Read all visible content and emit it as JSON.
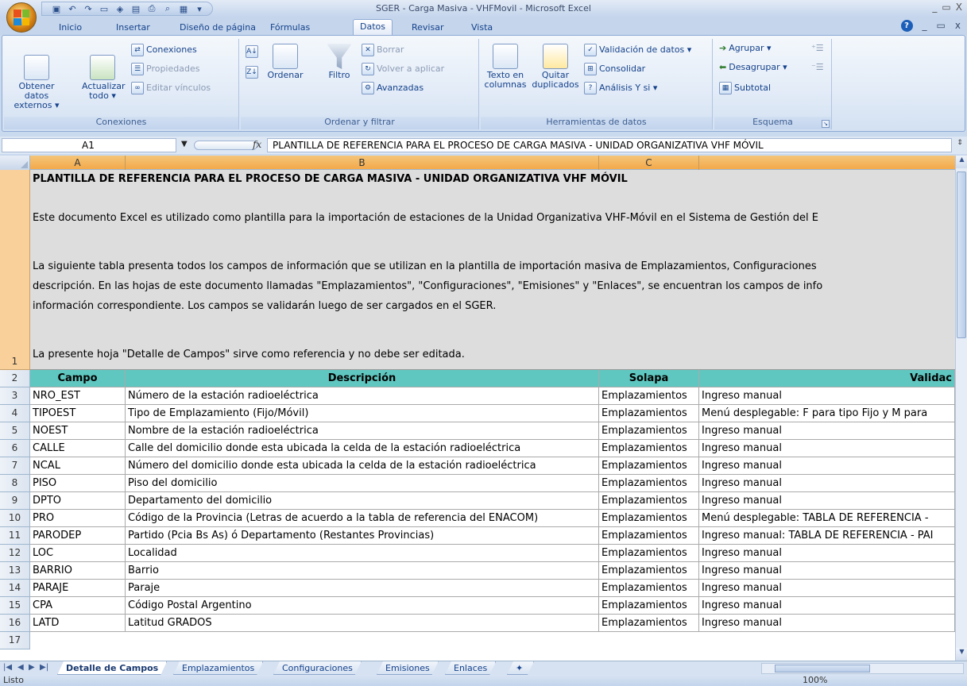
{
  "window": {
    "title": "SGER - Carga Masiva - VHFMovil - Microsoft Excel",
    "controls": [
      "_",
      "▭",
      "X"
    ]
  },
  "tabs": [
    "Inicio",
    "Insertar",
    "Diseño de página",
    "Fórmulas",
    "Datos",
    "Revisar",
    "Vista"
  ],
  "active_tab": "Datos",
  "ribbon": {
    "groups": {
      "conexiones": {
        "label": "Conexiones",
        "obtener": "Obtener datos externos ▾",
        "actualizar": "Actualizar todo ▾",
        "conexiones": "Conexiones",
        "propiedades": "Propiedades",
        "editar": "Editar vínculos"
      },
      "ordenar": {
        "label": "Ordenar y filtrar",
        "ordenar": "Ordenar",
        "filtro": "Filtro",
        "borrar": "Borrar",
        "volver": "Volver a aplicar",
        "avanzadas": "Avanzadas"
      },
      "herramientas": {
        "label": "Herramientas de datos",
        "texto": "Texto en columnas",
        "quitar": "Quitar duplicados",
        "validacion": "Validación de datos ▾",
        "consolidar": "Consolidar",
        "analisis": "Análisis Y si ▾"
      },
      "esquema": {
        "label": "Esquema",
        "agrupar": "Agrupar ▾",
        "desagrupar": "Desagrupar ▾",
        "subtotal": "Subtotal"
      }
    }
  },
  "formula_bar": {
    "name_box": "A1",
    "fx": "fx",
    "content": "PLANTILLA DE REFERENCIA PARA EL PROCESO DE CARGA MASIVA - UNIDAD ORGANIZATIVA VHF MÓVIL"
  },
  "columns": [
    "A",
    "B",
    "C"
  ],
  "row1": {
    "title": "PLANTILLA DE REFERENCIA PARA EL PROCESO DE CARGA MASIVA - UNIDAD ORGANIZATIVA VHF MÓVIL",
    "p1": "Este documento Excel es utilizado como plantilla para la importación de estaciones de la Unidad Organizativa VHF-Móvil en el Sistema de Gestión del E",
    "p2a": "La siguiente tabla presenta todos los campos de información que se utilizan en la plantilla de importación masiva de Emplazamientos, Configuraciones",
    "p2b": "descripción. En las hojas de este documento llamadas \"Emplazamientos\", \"Configuraciones\", \"Emisiones\" y \"Enlaces\", se encuentran los campos de info",
    "p2c": "información correspondiente. Los campos se validarán luego de ser cargados en el SGER.",
    "p3": "La presente hoja \"Detalle de Campos\" sirve como referencia y no debe ser editada."
  },
  "table": {
    "headers": [
      "Campo",
      "Descripción",
      "Solapa",
      "Validac"
    ],
    "rows": [
      [
        "NRO_EST",
        "Número de la estación radioeléctrica",
        "Emplazamientos",
        "Ingreso manual"
      ],
      [
        "TIPOEST",
        "Tipo de Emplazamiento (Fijo/Móvil)",
        "Emplazamientos",
        "Menú desplegable: F para tipo Fijo y M para"
      ],
      [
        "NOEST",
        "Nombre de la estación radioeléctrica",
        "Emplazamientos",
        "Ingreso manual"
      ],
      [
        "CALLE",
        "Calle del domicilio donde esta ubicada la celda de la estación radioeléctrica",
        "Emplazamientos",
        "Ingreso manual"
      ],
      [
        "NCAL",
        "Número del domicilio donde esta ubicada la celda de la estación radioeléctrica",
        "Emplazamientos",
        "Ingreso manual"
      ],
      [
        "PISO",
        "Piso del domicilio",
        "Emplazamientos",
        "Ingreso manual"
      ],
      [
        "DPTO",
        "Departamento del domicilio",
        "Emplazamientos",
        "Ingreso manual"
      ],
      [
        "PRO",
        "Código de la Provincia (Letras de acuerdo a la tabla de referencia del ENACOM)",
        "Emplazamientos",
        "Menú desplegable: TABLA DE REFERENCIA -"
      ],
      [
        "PARODEP",
        "Partido (Pcia Bs As) ó Departamento (Restantes Provincias)",
        "Emplazamientos",
        "Ingreso manual: TABLA DE REFERENCIA - PAI"
      ],
      [
        "LOC",
        "Localidad",
        "Emplazamientos",
        "Ingreso manual"
      ],
      [
        "BARRIO",
        "Barrio",
        "Emplazamientos",
        "Ingreso manual"
      ],
      [
        "PARAJE",
        "Paraje",
        "Emplazamientos",
        "Ingreso manual"
      ],
      [
        "CPA",
        "Código Postal Argentino",
        "Emplazamientos",
        "Ingreso manual"
      ],
      [
        "LATD",
        "Latitud GRADOS",
        "Emplazamientos",
        "Ingreso manual"
      ]
    ],
    "row_numbers": [
      "3",
      "4",
      "5",
      "6",
      "7",
      "8",
      "9",
      "10",
      "11",
      "12",
      "13",
      "14",
      "15",
      "16",
      "17"
    ]
  },
  "sheets": [
    "Detalle de Campos",
    "Emplazamientos",
    "Configuraciones",
    "Emisiones",
    "Enlaces"
  ],
  "active_sheet": "Detalle de Campos",
  "status": {
    "text": "Listo",
    "zoom": "100%"
  },
  "colors": {
    "header_teal": "#5fc7c0",
    "row1_bg": "#dddddd",
    "col_highlight": "#f3a94a"
  }
}
